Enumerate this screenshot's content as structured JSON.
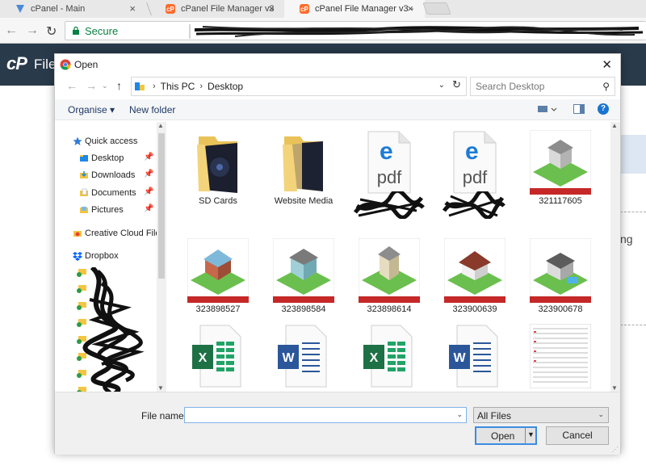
{
  "browser": {
    "tabs": [
      {
        "title": "cPanel - Main",
        "icon": "cpanel-shield-icon"
      },
      {
        "title": "cPanel File Manager v3",
        "icon": "cpanel-icon"
      },
      {
        "title": "cPanel File Manager v3 -",
        "icon": "cpanel-icon"
      }
    ],
    "secure_label": "Secure"
  },
  "cpanel": {
    "logo_text": "cP",
    "title": "File",
    "right_text": "ng"
  },
  "dialog": {
    "title": "Open",
    "path": [
      "This PC",
      "Desktop"
    ],
    "search_placeholder": "Search Desktop",
    "organise_label": "Organise",
    "new_folder_label": "New folder",
    "nav": {
      "quick_access": "Quick access",
      "items": [
        {
          "label": "Desktop",
          "icon": "desktop-folder-icon",
          "pinned": true
        },
        {
          "label": "Downloads",
          "icon": "downloads-folder-icon",
          "pinned": true
        },
        {
          "label": "Documents",
          "icon": "documents-folder-icon",
          "pinned": true
        },
        {
          "label": "Pictures",
          "icon": "pictures-folder-icon",
          "pinned": true
        }
      ],
      "creative_cloud": "Creative Cloud Files",
      "dropbox": "Dropbox"
    },
    "files": [
      {
        "name": "SD Cards",
        "type": "folder"
      },
      {
        "name": "Website Media",
        "type": "folder"
      },
      {
        "name": "",
        "type": "pdf"
      },
      {
        "name": "",
        "type": "pdf"
      },
      {
        "name": "321117605",
        "type": "image"
      },
      {
        "name": "323898527",
        "type": "image"
      },
      {
        "name": "323898584",
        "type": "image"
      },
      {
        "name": "323898614",
        "type": "image"
      },
      {
        "name": "323900639",
        "type": "image"
      },
      {
        "name": "323900678",
        "type": "image"
      },
      {
        "name": "",
        "type": "excel"
      },
      {
        "name": "",
        "type": "word"
      },
      {
        "name": "",
        "type": "excel"
      },
      {
        "name": "",
        "type": "word"
      },
      {
        "name": "",
        "type": "document-preview"
      }
    ],
    "file_name_label": "File name:",
    "file_name_value": "",
    "file_type": "All Files",
    "open_label": "Open",
    "cancel_label": "Cancel"
  }
}
